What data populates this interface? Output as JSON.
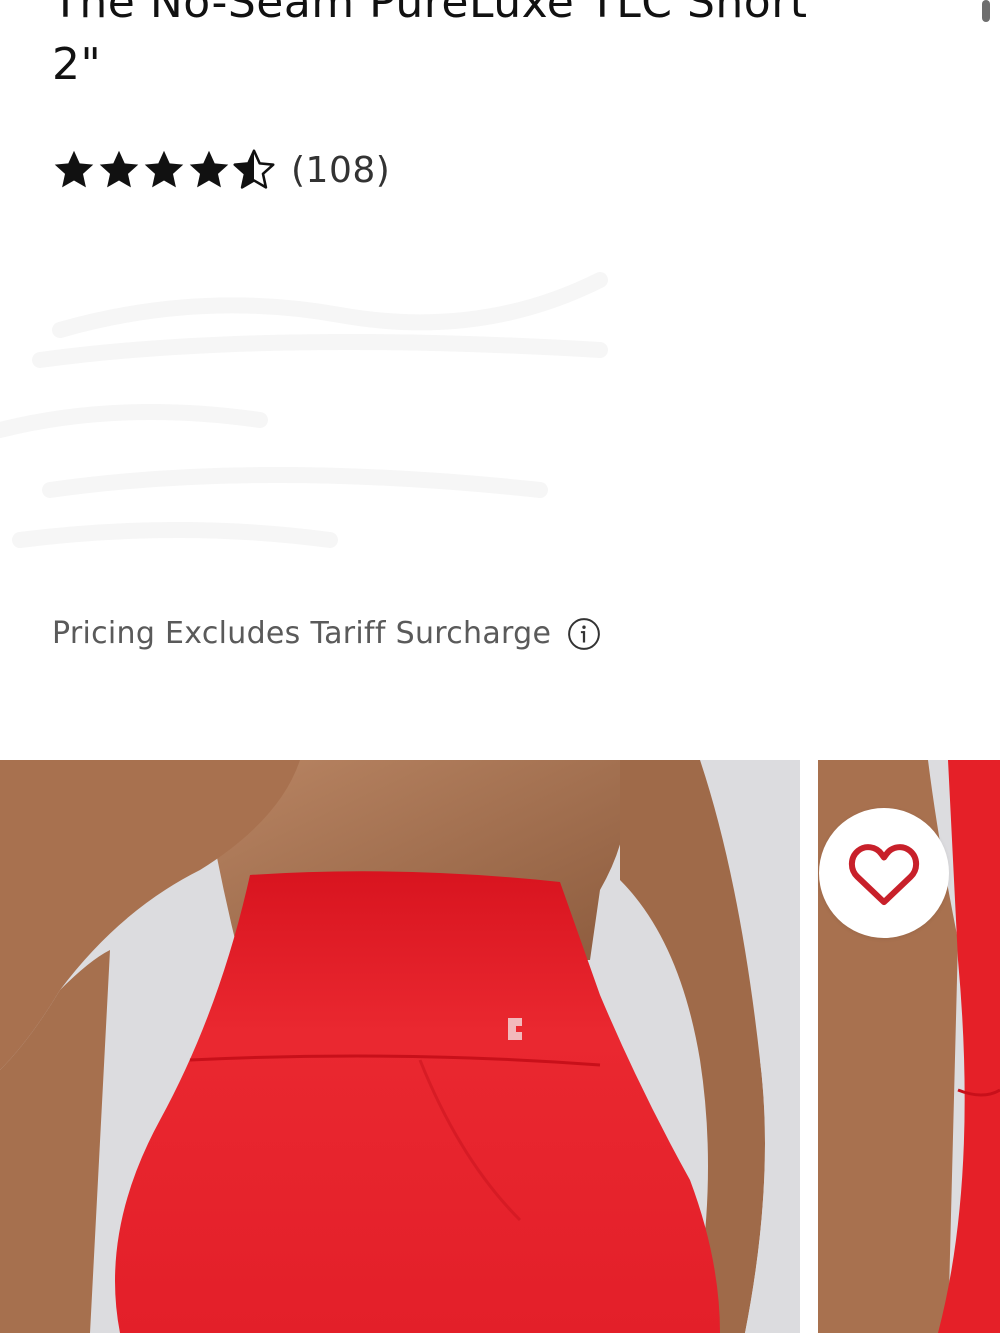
{
  "product": {
    "title_line1": "The No-Seam PureLuxe TLC Short",
    "title_line2": "2\"",
    "rating": {
      "stars": 4.5,
      "max_stars": 5,
      "review_count": "(108)"
    },
    "pricing_note": "Pricing Excludes Tariff Surcharge",
    "images": [
      {
        "alt": "product-photo-back-view"
      },
      {
        "alt": "product-photo-next"
      }
    ]
  },
  "icons": {
    "star": "star-icon",
    "info": "info-icon",
    "heart": "heart-icon"
  },
  "colors": {
    "product_red": "#e8212a",
    "heart_red": "#c8202a",
    "text_dark": "#111111",
    "text_muted": "#5a5a5a"
  }
}
